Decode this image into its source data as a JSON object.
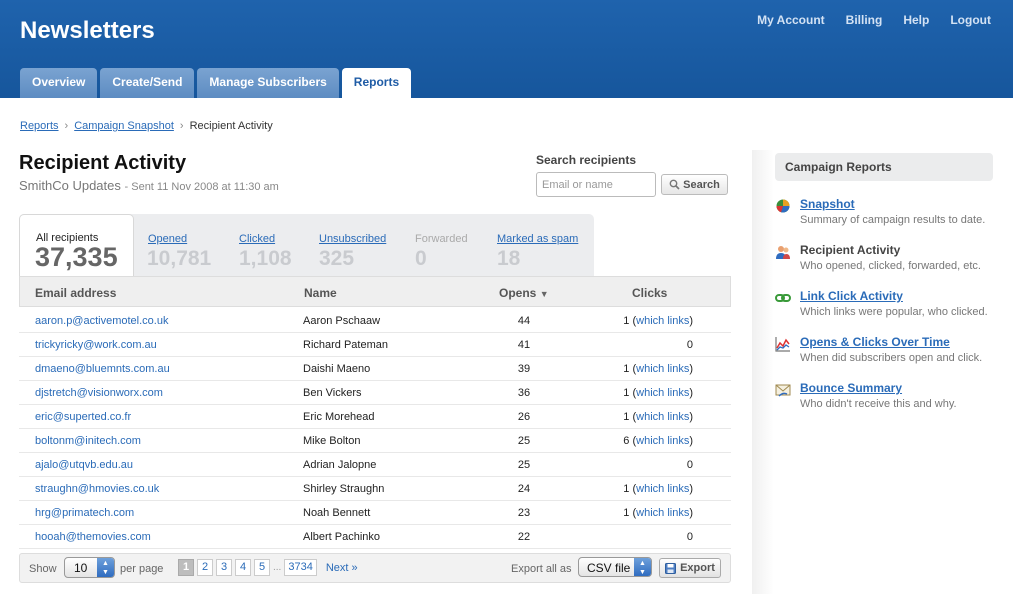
{
  "app": {
    "title": "Newsletters"
  },
  "top_nav": [
    "My Account",
    "Billing",
    "Help",
    "Logout"
  ],
  "tabs": [
    {
      "label": "Overview",
      "active": false
    },
    {
      "label": "Create/Send",
      "active": false
    },
    {
      "label": "Manage Subscribers",
      "active": false
    },
    {
      "label": "Reports",
      "active": true
    }
  ],
  "breadcrumb": [
    "Reports",
    "Campaign Snapshot",
    "Recipient Activity"
  ],
  "page": {
    "title": "Recipient Activity",
    "campaign": "SmithCo Updates",
    "sent": "- Sent 11 Nov 2008 at 11:30 am"
  },
  "search": {
    "label": "Search recipients",
    "placeholder": "Email or name",
    "button": "Search"
  },
  "stats": [
    {
      "label": "All recipients",
      "value": "37,335"
    },
    {
      "label": "Opened",
      "value": "10,781"
    },
    {
      "label": "Clicked",
      "value": "1,108"
    },
    {
      "label": "Unsubscribed",
      "value": "325"
    },
    {
      "label": "Forwarded",
      "value": "0"
    },
    {
      "label": "Marked as spam",
      "value": "18"
    }
  ],
  "table": {
    "headers": {
      "email": "Email address",
      "name": "Name",
      "opens": "Opens",
      "clicks": "Clicks"
    },
    "which_links": "which links",
    "rows": [
      {
        "email": "aaron.p@activemotel.co.uk",
        "name": "Aaron Pschaaw",
        "opens": "44",
        "clicks": "1"
      },
      {
        "email": "trickyricky@work.com.au",
        "name": "Richard Pateman",
        "opens": "41",
        "clicks": "0"
      },
      {
        "email": "dmaeno@bluemnts.com.au",
        "name": "Daishi Maeno",
        "opens": "39",
        "clicks": "1"
      },
      {
        "email": "djstretch@visionworx.com",
        "name": "Ben Vickers",
        "opens": "36",
        "clicks": "1"
      },
      {
        "email": "eric@superted.co.fr",
        "name": "Eric Morehead",
        "opens": "26",
        "clicks": "1"
      },
      {
        "email": "boltonm@initech.com",
        "name": "Mike Bolton",
        "opens": "25",
        "clicks": "6"
      },
      {
        "email": "ajalo@utqvb.edu.au",
        "name": "Adrian Jalopne",
        "opens": "25",
        "clicks": "0"
      },
      {
        "email": "straughn@hmovies.co.uk",
        "name": "Shirley Straughn",
        "opens": "24",
        "clicks": "1"
      },
      {
        "email": "hrg@primatech.com",
        "name": "Noah Bennett",
        "opens": "23",
        "clicks": "1"
      },
      {
        "email": "hooah@themovies.com",
        "name": "Albert Pachinko",
        "opens": "22",
        "clicks": "0"
      }
    ]
  },
  "pager": {
    "show_label": "Show",
    "per_page_value": "10",
    "per_page_label": "per page",
    "pages": [
      "1",
      "2",
      "3",
      "4",
      "5"
    ],
    "ellipsis": "...",
    "last_page": "3734",
    "next": "Next »",
    "export_label": "Export all as",
    "export_format": "CSV file",
    "export_button": "Export"
  },
  "sidebar": {
    "title": "Campaign Reports",
    "items": [
      {
        "title": "Snapshot",
        "desc": "Summary of campaign results to date.",
        "icon": "pie-chart-icon"
      },
      {
        "title": "Recipient Activity",
        "desc": "Who opened, clicked, forwarded, etc.",
        "icon": "people-icon"
      },
      {
        "title": "Link Click Activity",
        "desc": "Which links were popular, who clicked.",
        "icon": "link-icon"
      },
      {
        "title": "Opens & Clicks Over Time",
        "desc": "When did subscribers open and click.",
        "icon": "line-chart-icon"
      },
      {
        "title": "Bounce Summary",
        "desc": "Who didn't receive this and why.",
        "icon": "bounce-icon"
      }
    ]
  },
  "colors": {
    "header": "#1a5ba3",
    "link": "#2a6bb8",
    "tab_inactive": "#6a97cc"
  }
}
